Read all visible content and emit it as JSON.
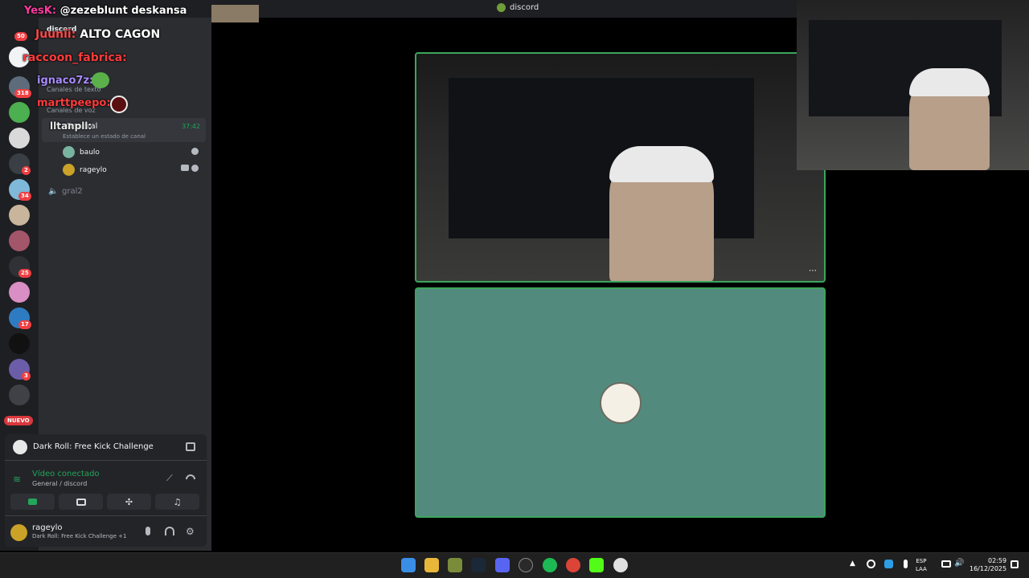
{
  "window": {
    "title": "discord"
  },
  "chat_overlay": {
    "lines": [
      {
        "user": "YesK:",
        "message": "@zezeblunt deskansa",
        "color": "#ff3ba0"
      },
      {
        "user": "Juunii:",
        "message": "ALTO CAGON",
        "color": "#ff4848"
      },
      {
        "user": "raccoon_fabrica:",
        "message": "",
        "color": "#ff3b3b"
      },
      {
        "user": "ignaco7z:",
        "message": "",
        "color": "#a98bff"
      },
      {
        "user": "marttpeepo:",
        "message": "",
        "color": "#ff3b3b"
      },
      {
        "user": "lltanpll:",
        "message": "",
        "color": "#e9e9e9"
      }
    ]
  },
  "server_rail": {
    "badges": [
      "50",
      "318",
      "2",
      "34",
      "25",
      "17",
      "3"
    ],
    "nuevo_label": "NUEVO"
  },
  "sidebar": {
    "server_name": "discord",
    "categories": {
      "text": "Canales de texto",
      "voice": "Canales de voz"
    },
    "active_channel": {
      "name": "General",
      "timer": "37:42",
      "status_hint": "Establece un estado de canal"
    },
    "voice_users": [
      {
        "name": "baulo"
      },
      {
        "name": "rageylo"
      }
    ],
    "other_voice_channel": "gral2"
  },
  "voice_panel": {
    "activity": "Dark Roll: Free Kick Challenge",
    "status": "Vídeo conectado",
    "location": "General / discord"
  },
  "user_area": {
    "username": "rageylo",
    "status": "Dark Roll: Free Kick Challenge +1"
  },
  "taskbar": {
    "language": [
      "ESP",
      "LAA"
    ],
    "time": "02:59",
    "date": "16/12/2025"
  }
}
